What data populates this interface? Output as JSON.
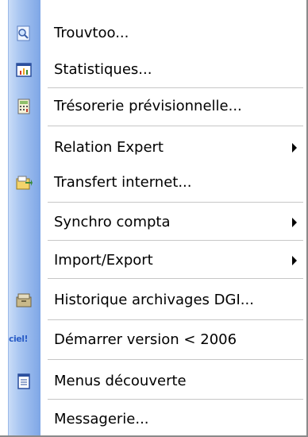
{
  "menu": {
    "items": [
      {
        "label": "Trouvtoo...",
        "icon": "search-icon",
        "submenu": false
      },
      {
        "label": "Statistiques...",
        "icon": "chart-icon",
        "submenu": false
      },
      {
        "label": "Trésorerie prévisionnelle...",
        "icon": "calculator-icon",
        "submenu": false
      },
      {
        "label": "Relation Expert",
        "icon": "",
        "submenu": true
      },
      {
        "label": "Transfert internet...",
        "icon": "transfer-icon",
        "submenu": false
      },
      {
        "label": "Synchro compta",
        "icon": "",
        "submenu": true
      },
      {
        "label": "Import/Export",
        "icon": "",
        "submenu": true
      },
      {
        "label": "Historique archivages DGI...",
        "icon": "archive-icon",
        "submenu": false
      },
      {
        "label": "Démarrer version < 2006",
        "icon": "ciel-logo",
        "icon_text": "ciel!",
        "submenu": false
      },
      {
        "label": "Menus découverte",
        "icon": "document-icon",
        "submenu": false
      },
      {
        "label": "Messagerie...",
        "icon": "",
        "submenu": false
      }
    ]
  },
  "colors": {
    "gutter": "#a9c6f1",
    "separator": "#c7c7c7",
    "text": "#000000",
    "ciel_logo": "#2a5dc7"
  }
}
